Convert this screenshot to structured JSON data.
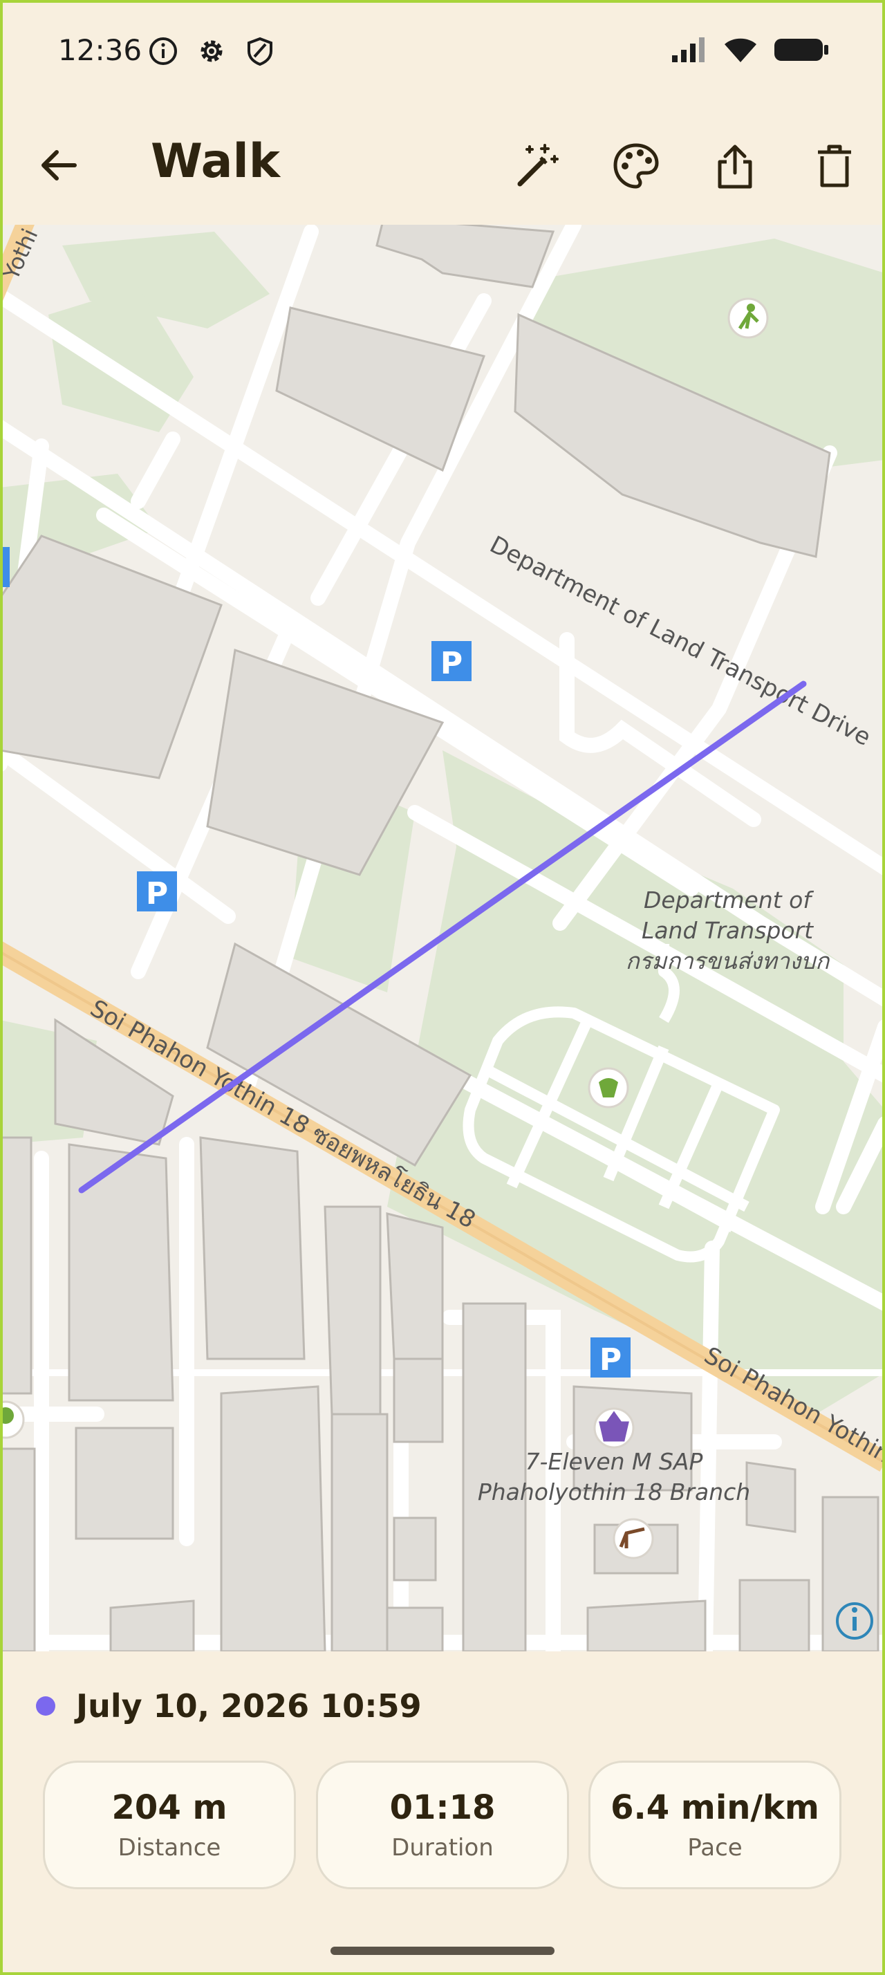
{
  "status_bar": {
    "time": "12:36",
    "left_icons": [
      "info-icon",
      "settings-gear-icon",
      "shield-icon"
    ],
    "right_icons": [
      "signal-icon",
      "wifi-icon",
      "battery-icon"
    ]
  },
  "app_bar": {
    "back_icon": "arrow-left-icon",
    "title": "Walk",
    "actions": [
      "magic-wand-icon",
      "palette-icon",
      "share-icon",
      "delete-icon"
    ]
  },
  "map": {
    "road_labels": {
      "dlt_drive": "Department of Land Transport Drive",
      "soi_upper": "Soi Phahon Yothin 18 ซอยพหลโยธิน 18",
      "soi_lower": "Soi Phahon Yothin",
      "yothi": "Yothi"
    },
    "poi": {
      "dlt_line1": "Department of",
      "dlt_line2": "Land Transport",
      "dlt_line3": "กรมการขนส่งทางบก",
      "seven_line1": "7-Eleven M SAP",
      "seven_line2": "Phaholyothin 18 Branch",
      "parking": "P"
    },
    "route_color": "#7b68ee",
    "info_icon": "info-circle-icon"
  },
  "activity": {
    "date": "July 10, 2026 10:59",
    "color": "#7b68ee",
    "stats": [
      {
        "value": "204 m",
        "label": "Distance"
      },
      {
        "value": "01:18",
        "label": "Duration"
      },
      {
        "value": "6.4 min/km",
        "label": "Pace"
      }
    ]
  }
}
